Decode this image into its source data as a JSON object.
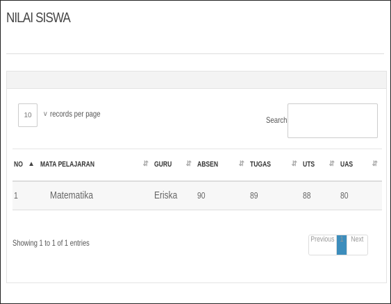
{
  "page": {
    "title": "NILAI SISWA"
  },
  "datatable": {
    "length": {
      "value": "10",
      "label": "records per page"
    },
    "search": {
      "label": "Search:",
      "value": ""
    },
    "columns": [
      "NO",
      "MATA PELAJARAN",
      "GURU",
      "ABSEN",
      "TUGAS",
      "UTS",
      "UAS"
    ],
    "rows": [
      [
        "1",
        "Matematika",
        "Eriska",
        "90",
        "89",
        "88",
        "80"
      ]
    ],
    "info": "Showing 1 to 1 of 1 entries",
    "pagination": {
      "previous": "Previous",
      "current": "1",
      "next": "Next"
    }
  },
  "colors": {
    "accent": "#3c8dbc",
    "panel_heading": "#f3f3f3",
    "row_bg": "#f7f7f7"
  },
  "icons": {
    "sort_asc": "sort-asc-icon",
    "sort_both": "sort-both-icon",
    "select_chevron": "chevron-down-icon"
  }
}
